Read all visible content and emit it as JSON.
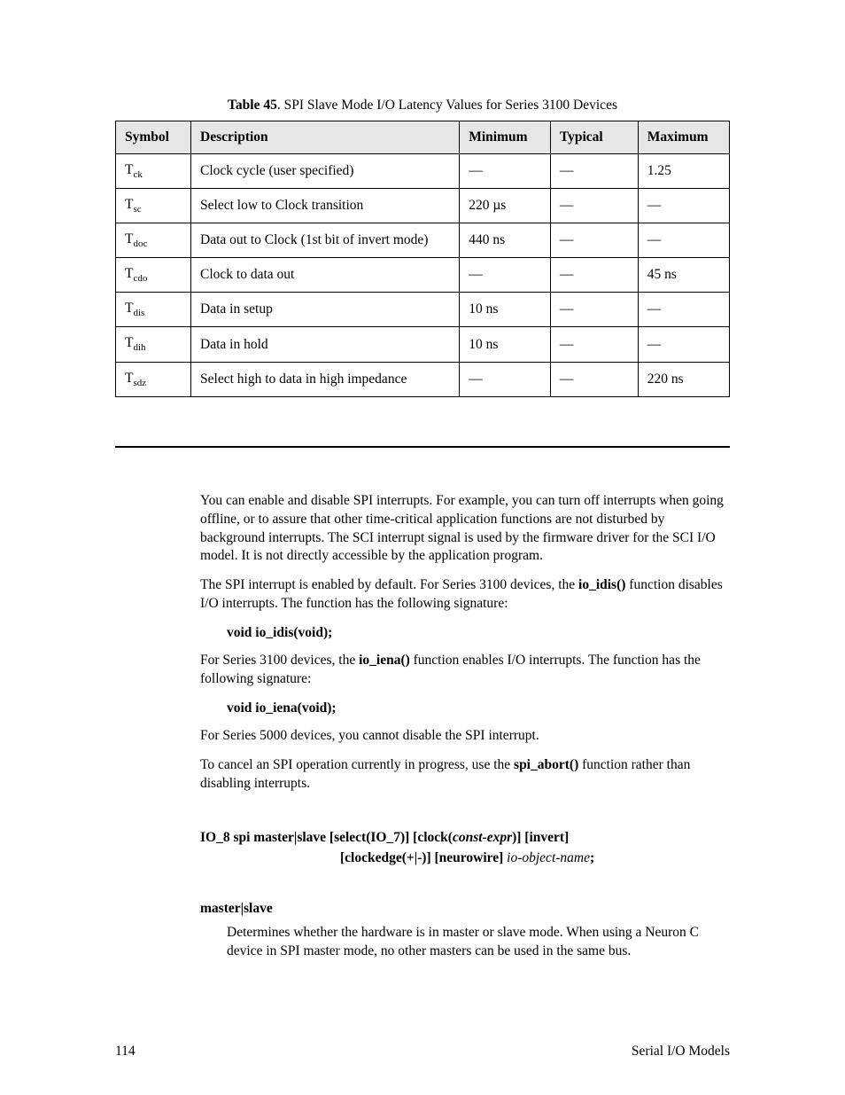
{
  "table": {
    "caption_label": "Table 45",
    "caption_text": ". SPI Slave Mode I/O Latency Values for Series 3100 Devices",
    "headers": [
      "Symbol",
      "Description",
      "Minimum",
      "Typical",
      "Maximum"
    ],
    "rows": [
      {
        "sym_main": "T",
        "sym_sub": "ck",
        "desc": "Clock cycle (user specified)",
        "min": "—",
        "typ": "—",
        "max": "1.25"
      },
      {
        "sym_main": "T",
        "sym_sub": "sc",
        "desc": "Select low to Clock transition",
        "min": "220 µs",
        "typ": "—",
        "max": "—"
      },
      {
        "sym_main": "T",
        "sym_sub": "doc",
        "desc": "Data out to Clock (1st bit of invert mode)",
        "min": "440 ns",
        "typ": "—",
        "max": "—"
      },
      {
        "sym_main": "T",
        "sym_sub": "cdo",
        "desc": "Clock to data out",
        "min": "—",
        "typ": "—",
        "max": "45 ns"
      },
      {
        "sym_main": "T",
        "sym_sub": "dis",
        "desc": "Data in setup",
        "min": "10 ns",
        "typ": "—",
        "max": "—"
      },
      {
        "sym_main": "T",
        "sym_sub": "dih",
        "desc": "Data in hold",
        "min": "10 ns",
        "typ": "—",
        "max": "—"
      },
      {
        "sym_main": "T",
        "sym_sub": "sdz",
        "desc": "Select high to data in high impedance",
        "min": "—",
        "typ": "—",
        "max": "220 ns"
      }
    ]
  },
  "para1": "You can enable and disable SPI interrupts.  For example, you can turn off interrupts when going offline, or to assure that other time-critical application functions are not disturbed by background interrupts.  The SCI interrupt signal is used by the firmware driver for the SCI I/O model.  It is not directly accessible by the application program.",
  "para2_a": "The SPI interrupt is enabled by default.  For Series 3100 devices, the ",
  "para2_b": "io_idis()",
  "para2_c": " function disables I/O interrupts.  The function has the following signature:",
  "sig1": "void io_idis(void);",
  "para3_a": "For Series 3100 devices, the ",
  "para3_b": "io_iena()",
  "para3_c": " function enables I/O interrupts.  The function has the following signature:",
  "sig2": "void io_iena(void);",
  "para4": "For Series 5000 devices, you cannot disable the SPI interrupt.",
  "para5_a": "To cancel an SPI operation currently in progress, use the ",
  "para5_b": "spi_abort()",
  "para5_c": " function rather than disabling interrupts.",
  "syntax": {
    "l1a": "IO_8 spi master|slave [select(IO_7)] [clock(",
    "l1b": "const-expr",
    "l1c": ")] [invert]",
    "l2a": "[clockedge(+|-)] [neurowire] ",
    "l2b": "io-object-name",
    "l2c": ";"
  },
  "term": "master|slave",
  "term_desc": "Determines whether the hardware is in master or slave mode.  When using a Neuron C device in SPI master mode, no other masters can be used in the same bus.",
  "footer_left": "114",
  "footer_right": "Serial I/O Models"
}
